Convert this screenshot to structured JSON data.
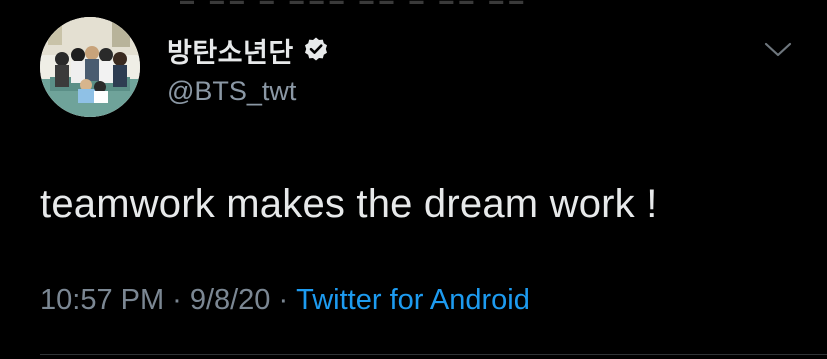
{
  "tweet": {
    "display_name": "방탄소년단",
    "handle": "@BTS_twt",
    "text": "teamwork makes the dream work !",
    "time": "10:57 PM",
    "date": "9/8/20",
    "separator": "·",
    "source": "Twitter for Android"
  },
  "icons": {
    "verified": "verified-badge-icon",
    "menu": "chevron-down-icon",
    "avatar": "profile-photo"
  },
  "colors": {
    "background": "#000000",
    "primary_text": "#e7e9ea",
    "secondary_text": "#7b8793",
    "link": "#1d9bf0",
    "divider": "#2f3336"
  }
}
